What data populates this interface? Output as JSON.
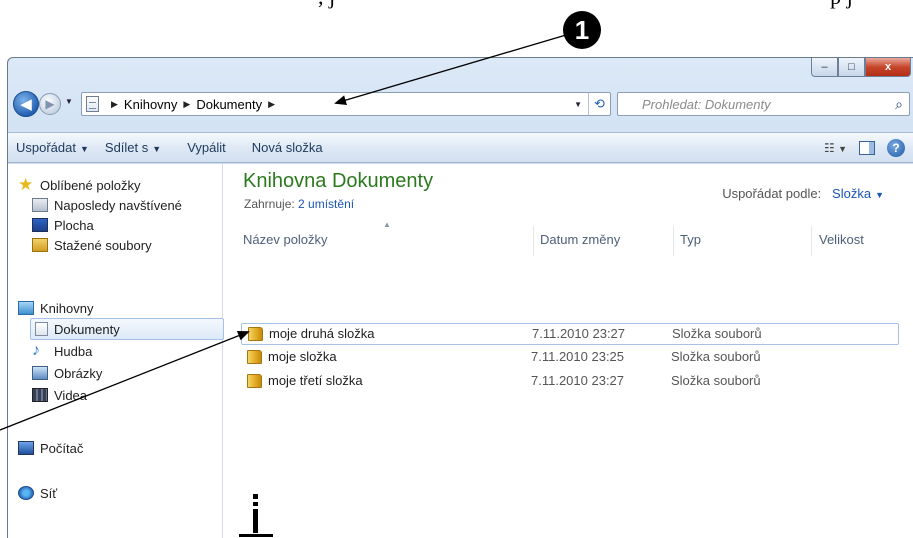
{
  "callout": {
    "number": "1"
  },
  "window": {
    "buttons": {
      "minimize": "–",
      "maximize": "□",
      "close": "x"
    },
    "nav": {
      "back": "◀",
      "forward": "▶",
      "breadcrumb": [
        "Knihovny",
        "Dokumenty"
      ],
      "search_placeholder": "Prohledat: Dokumenty"
    },
    "toolbar": {
      "organize": "Uspořádat",
      "share": "Sdílet s",
      "burn": "Vypálit",
      "new_folder": "Nová složka"
    },
    "navpane": {
      "favorites": "Oblíbené položky",
      "recent": "Naposledy navštívené",
      "desktop": "Plocha",
      "downloads": "Stažené soubory",
      "libraries": "Knihovny",
      "documents": "Dokumenty",
      "music": "Hudba",
      "pictures": "Obrázky",
      "videos": "Videa",
      "computer": "Počítač",
      "network": "Síť"
    },
    "library": {
      "title": "Knihovna Dokumenty",
      "includes_label": "Zahrnuje:",
      "includes_link": "2 umístění",
      "arrange_label": "Uspořádat podle:",
      "arrange_value": "Složka"
    },
    "columns": {
      "name": "Název položky",
      "date": "Datum změny",
      "type": "Typ",
      "size": "Velikost"
    },
    "files": [
      {
        "name": "moje druhá složka",
        "date": "7.11.2010 23:27",
        "type": "Složka souborů"
      },
      {
        "name": "moje složka",
        "date": "7.11.2010 23:25",
        "type": "Složka souborů"
      },
      {
        "name": "moje třetí složka",
        "date": "7.11.2010 23:27",
        "type": "Složka souborů"
      }
    ]
  }
}
